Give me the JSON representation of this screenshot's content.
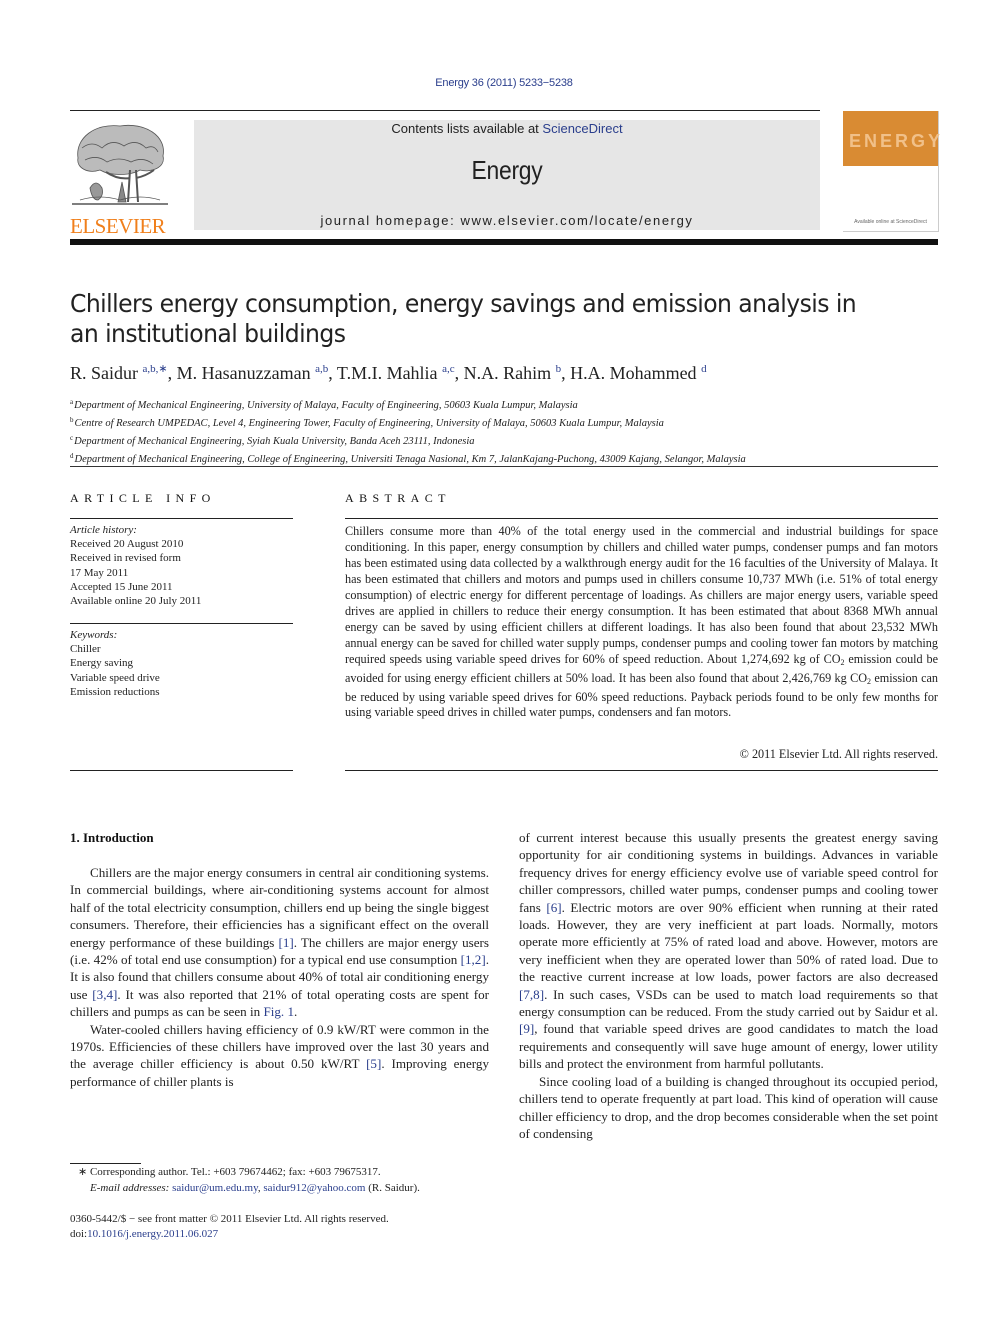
{
  "header": {
    "citation": "Energy 36 (2011) 5233−5238",
    "contents_prefix": "Contents lists available at ",
    "contents_link": "ScienceDirect",
    "journal_name": "Energy",
    "homepage": "journal homepage: www.elsevier.com/locate/energy",
    "publisher_logo_text": "ELSEVIER",
    "cover_word": "ENERGY",
    "cover_footer": "Available online at ScienceDirect",
    "colors": {
      "publisher_orange": "#f07f1b",
      "link_blue": "#2a3e8c",
      "band_gray": "#e6e6e6",
      "cover_orange": "#d98b33"
    }
  },
  "article": {
    "title": "Chillers energy consumption, energy savings and emission analysis in an institutional buildings",
    "authors": [
      {
        "name": "R. Saidur",
        "sup": "a,b,∗"
      },
      {
        "name": "M. Hasanuzzaman",
        "sup": "a,b"
      },
      {
        "name": "T.M.I. Mahlia",
        "sup": "a,c"
      },
      {
        "name": "N.A. Rahim",
        "sup": "b"
      },
      {
        "name": "H.A. Mohammed",
        "sup": "d"
      }
    ],
    "affiliations": [
      {
        "key": "a",
        "text": "Department of Mechanical Engineering, University of Malaya, Faculty of Engineering, 50603 Kuala Lumpur, Malaysia"
      },
      {
        "key": "b",
        "text": "Centre of Research UMPEDAC, Level 4, Engineering Tower, Faculty of Engineering, University of Malaya, 50603 Kuala Lumpur, Malaysia"
      },
      {
        "key": "c",
        "text": "Department of Mechanical Engineering, Syiah Kuala University, Banda Aceh 23111, Indonesia"
      },
      {
        "key": "d",
        "text": "Department of Mechanical Engineering, College of Engineering, Universiti Tenaga Nasional, Km 7, JalanKajang-Puchong, 43009 Kajang, Selangor, Malaysia"
      }
    ]
  },
  "article_info": {
    "heading": "ARTICLE INFO",
    "history_label": "Article history:",
    "history": [
      "Received 20 August 2010",
      "Received in revised form",
      "17 May 2011",
      "Accepted 15 June 2011",
      "Available online 20 July 2011"
    ],
    "keywords_label": "Keywords:",
    "keywords": [
      "Chiller",
      "Energy saving",
      "Variable speed drive",
      "Emission reductions"
    ]
  },
  "abstract": {
    "heading": "ABSTRACT",
    "part1": "Chillers consume more than 40% of the total energy used in the commercial and industrial buildings for space conditioning. In this paper, energy consumption by chillers and chilled water pumps, condenser pumps and fan motors has been estimated using data collected by a walkthrough energy audit for the 16 faculties of the University of Malaya. It has been estimated that chillers and motors and pumps used in chillers consume 10,737 MWh (i.e. 51% of total energy consumption) of electric energy for different percentage of loadings. As chillers are major energy users, variable speed drives are applied in chillers to reduce their energy consumption. It has been estimated that about 8368 MWh annual energy can be saved by using efficient chillers at different loadings. It has also been found that about 23,532 MWh annual energy can be saved for chilled water supply pumps, condenser pumps and cooling tower fan motors by matching required speeds using variable speed drives for 60% of speed reduction. About 1,274,692 kg of CO",
    "sub1": "2",
    "part2": " emission could be avoided for using energy efficient chillers at 50% load. It has been also found that about 2,426,769 kg CO",
    "sub2": "2",
    "part3": " emission can be reduced by using variable speed drives for 60% speed reductions. Payback periods found to be only few months for using variable speed drives in chilled water pumps, condensers and fan motors.",
    "copyright": "© 2011 Elsevier Ltd. All rights reserved."
  },
  "body": {
    "section_heading": "1.  Introduction",
    "left_p1": [
      {
        "t": "Chillers are the major energy consumers in central air conditioning systems. In commercial buildings, where air-conditioning systems account for almost half of the total electricity consumption, chillers end up being the single biggest consumers. Therefore, their efficiencies has a significant effect on the overall energy performance of these buildings "
      },
      {
        "ref": "[1]"
      },
      {
        "t": ". The chillers are major energy users (i.e. 42% of total end use consumption) for a typical end use consumption "
      },
      {
        "ref": "[1,2]"
      },
      {
        "t": ". It is also found that chillers consume about 40% of total air conditioning energy use "
      },
      {
        "ref": "[3,4]"
      },
      {
        "t": ". It was also reported that 21% of total operating costs are spent for chillers and pumps as can be seen in "
      },
      {
        "ref": "Fig. 1"
      },
      {
        "t": "."
      }
    ],
    "left_p2": [
      {
        "t": "Water-cooled chillers having efficiency of 0.9 kW/RT were common in the 1970s. Efficiencies of these chillers have improved over the last 30 years and the average chiller efficiency is about 0.50 kW/RT "
      },
      {
        "ref": "[5]"
      },
      {
        "t": ". Improving energy performance of chiller plants is"
      }
    ],
    "right_p1": [
      {
        "t": "of current interest because this usually presents the greatest energy saving opportunity for air conditioning systems in buildings. Advances in variable frequency drives for energy efficiency evolve use of variable speed control for chiller compressors, chilled water pumps, condenser pumps and cooling tower fans "
      },
      {
        "ref": "[6]"
      },
      {
        "t": ". Electric motors are over 90% efficient when running at their rated loads. However, they are very inefficient at part loads. Normally, motors operate more efficiently at 75% of rated load and above. However, motors are very inefficient when they are operated lower than 50% of rated load. Due to the reactive current increase at low loads, power factors are also decreased "
      },
      {
        "ref": "[7,8]"
      },
      {
        "t": ". In such cases, VSDs can be used to match load requirements so that energy consumption can be reduced. From the study carried out by Saidur et al. "
      },
      {
        "ref": "[9]"
      },
      {
        "t": ", found that variable speed drives are good candidates to match the load requirements and consequently will save huge amount of energy, lower utility bills and protect the environment from harmful pollutants."
      }
    ],
    "right_p2": [
      {
        "t": "Since cooling load of a building is changed throughout its occupied period, chillers tend to operate frequently at part load. This kind of operation will cause chiller efficiency to drop, and the drop becomes considerable when the set point of condensing"
      }
    ]
  },
  "footnote": {
    "corresponding": "∗  Corresponding author. Tel.: +603 79674462; fax: +603 79675317.",
    "email_label": "E-mail addresses:",
    "email1": "saidur@um.edu.my",
    "email2": "saidur912@yahoo.com",
    "email_suffix": " (R. Saidur)."
  },
  "front_matter": {
    "issn_line": "0360-5442/$ − see front matter © 2011 Elsevier Ltd. All rights reserved.",
    "doi_label": "doi:",
    "doi": "10.1016/j.energy.2011.06.027"
  }
}
